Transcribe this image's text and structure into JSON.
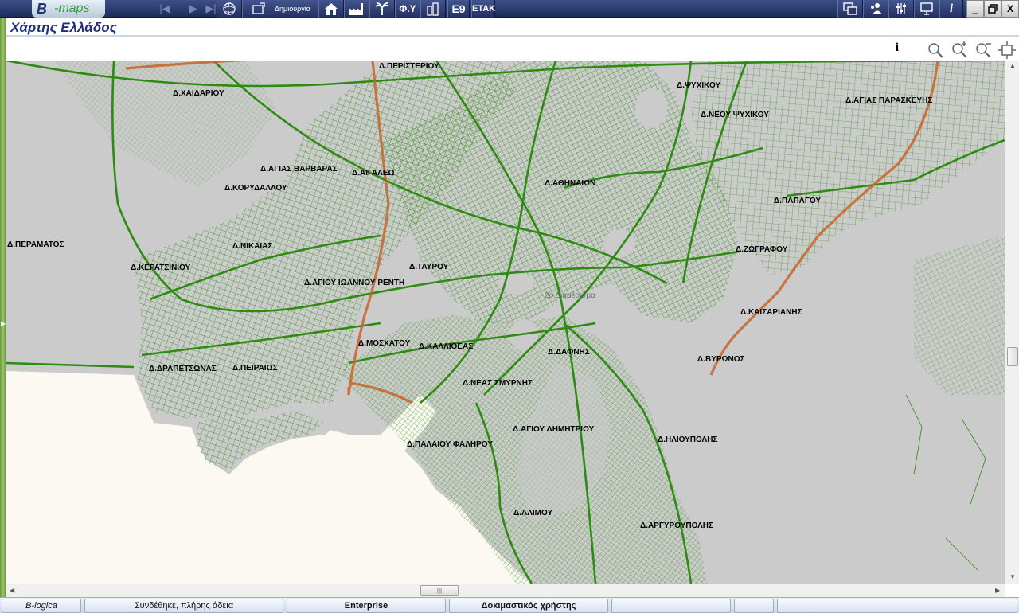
{
  "app": {
    "logo_prefix": "B",
    "logo_suffix": "-maps"
  },
  "toolbar": {
    "create_label": "Δημιουργία",
    "fy_label": "Φ.Υ",
    "e9_label": "E9",
    "etak_label": "ΕΤΑΚ",
    "info_label": "i"
  },
  "window": {
    "minimize": "_",
    "close": "X"
  },
  "page": {
    "title": "Χάρτης Ελλάδος"
  },
  "maptools": {
    "info_label": "i"
  },
  "map": {
    "labels": [
      "Δ.ΠΕΡΙΣΤΕΡΙΟΥ",
      "Δ.ΧΑΙΔΑΡΙΟΥ",
      "Δ.ΨΥΧΙΚΟΥ",
      "Δ.ΑΓΙΑΣ ΠΑΡΑΣΚΕΥΗΣ",
      "Δ.ΝΕΟΥ ΨΥΧΙΚΟΥ",
      "Δ.ΑΓΙΑΣ ΒΑΡΒΑΡΑΣ",
      "Δ.ΑΙΓΑΛΕΩ",
      "Δ.ΚΟΡΥΔΑΛΛΟΥ",
      "Δ.ΑΘΗΝΑΙΩΝ",
      "Δ.ΠΑΠΑΓΟΥ",
      "Δ.ΠΕΡΑΜΑΤΟΣ",
      "Δ.ΝΙΚΑΙΑΣ",
      "Δ.ΖΩΓΡΑΦΟΥ",
      "Δ.ΚΕΡΑΤΣΙΝΙΟΥ",
      "Δ.ΤΑΥΡΟΥ",
      "Δ.ΑΓΙΟΥ ΙΩΑΝΝΟΥ ΡΕΝΤΗ",
      "Δ.ΚΑΙΣΑΡΙΑΝΗΣ",
      "Δ.ΜΟΣΧΑΤΟΥ",
      "Δ.ΚΑΛΛΙΘΕΑΣ",
      "Δ.ΔΑΦΝΗΣ",
      "Δ.ΒΥΡΩΝΟΣ",
      "Δ.ΔΡΑΠΕΤΣΩΝΑΣ",
      "Δ.ΠΕΙΡΑΙΩΣ",
      "Δ.ΝΕΑΣ ΣΜΥΡΝΗΣ",
      "Δ.ΑΓΙΟΥ ΔΗΜΗΤΡΙΟΥ",
      "Δ.ΗΛΙΟΥΠΟΛΗΣ",
      "Δ.ΠΑΛΑΙΟΥ ΦΑΛΗΡΟΥ",
      "Δ.ΑΛΙΜΟΥ",
      "Δ.ΑΡΓΥΡΟΥΠΟΛΗΣ"
    ],
    "faint_labels": [
      "2ο Διαμέρισμα"
    ]
  },
  "status": {
    "company": "B-logica",
    "connection": "Συνδέθηκε, πλήρης άδεια",
    "edition": "Enterprise",
    "user": "Δοκιμαστικός χρήστης",
    "extra1": "",
    "extra2": ""
  },
  "colors": {
    "toolbar": "#22305e",
    "roads": "#2e8b12",
    "highway": "#c86428",
    "land": "#cbcbcb",
    "sea": "#fbf9f1",
    "title": "#1f2f7a"
  }
}
